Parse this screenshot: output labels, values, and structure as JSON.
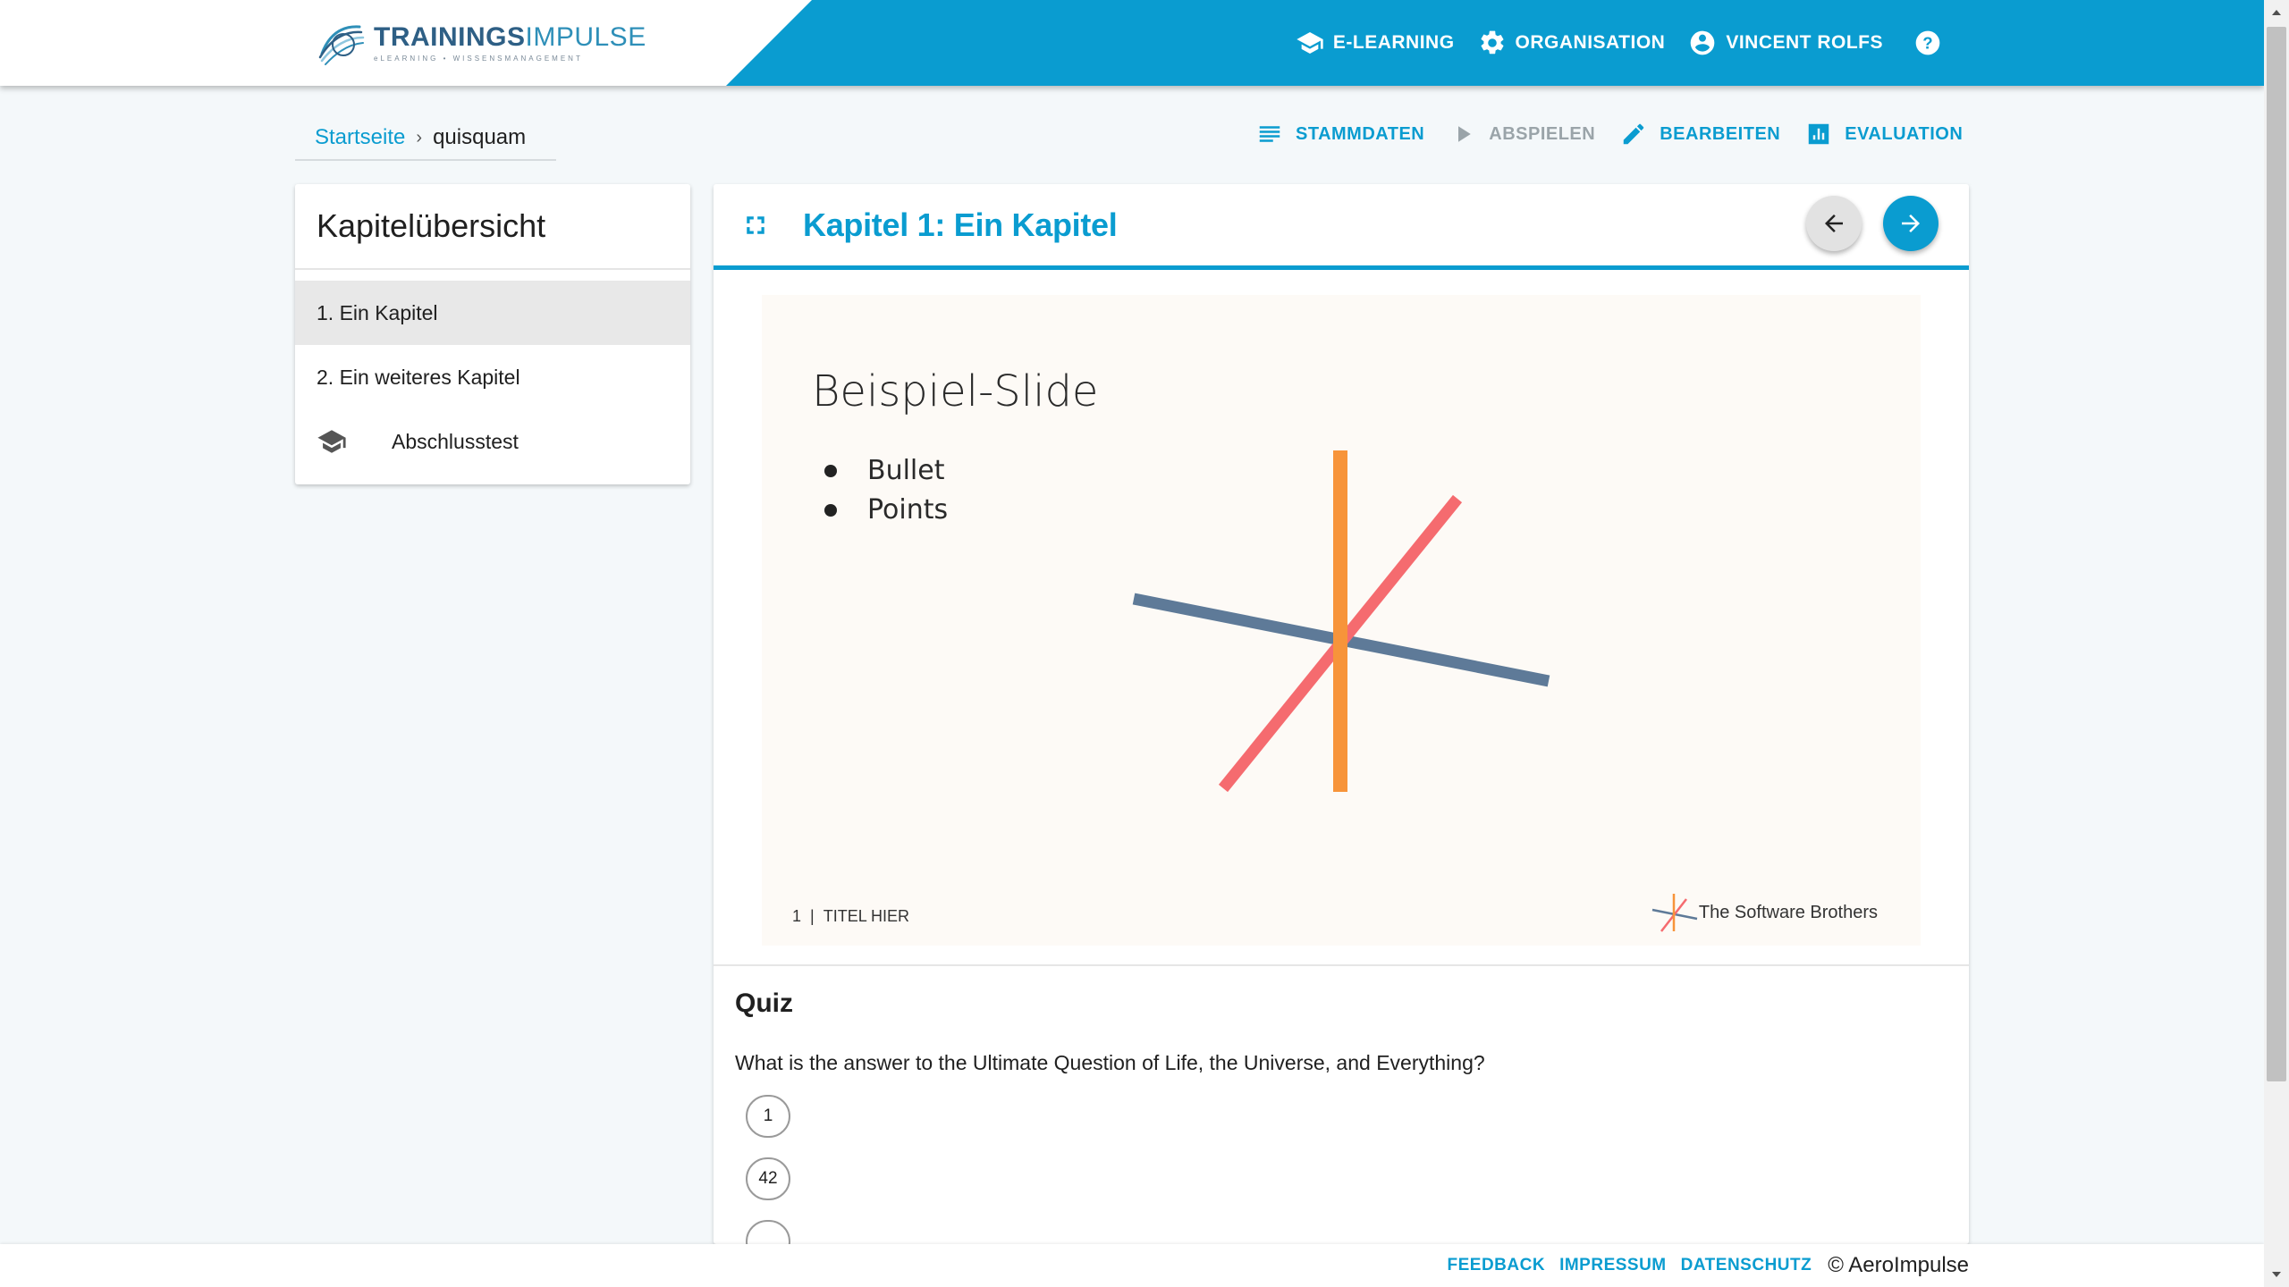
{
  "header": {
    "logo": {
      "brand_bold": "TRAININGS",
      "brand_light": "IMPULSE",
      "tagline": "eLEARNING • WISSENSMANAGEMENT"
    },
    "nav": [
      {
        "label": "E-LEARNING",
        "icon": "graduation-cap-icon"
      },
      {
        "label": "ORGANISATION",
        "icon": "gear-icon"
      },
      {
        "label": "VINCENT ROLFS",
        "icon": "account-circle-icon"
      }
    ],
    "help_icon": "help-circle-icon"
  },
  "breadcrumb": {
    "home": "Startseite",
    "separator": "›",
    "current": "quisquam"
  },
  "actions": [
    {
      "label": "STAMMDATEN",
      "icon": "list-icon",
      "enabled": true
    },
    {
      "label": "ABSPIELEN",
      "icon": "play-icon",
      "enabled": false
    },
    {
      "label": "BEARBEITEN",
      "icon": "pencil-icon",
      "enabled": true
    },
    {
      "label": "EVALUATION",
      "icon": "bar-chart-icon",
      "enabled": true
    }
  ],
  "sidebar": {
    "title": "Kapitelübersicht",
    "items": [
      {
        "label": "1. Ein Kapitel",
        "active": true
      },
      {
        "label": "2. Ein weiteres Kapitel",
        "active": false
      },
      {
        "label": "Abschlusstest",
        "active": false,
        "icon": "graduation-cap-icon"
      }
    ]
  },
  "chapter": {
    "title": "Kapitel 1: Ein Kapitel",
    "slide": {
      "title": "Beispiel-Slide",
      "bullets": [
        "Bullet",
        "Points"
      ],
      "footer_number": "1",
      "footer_separator": "|",
      "footer_text": "TITEL HIER",
      "brand": "The Software Brothers"
    },
    "quiz": {
      "title": "Quiz",
      "question": "What is the answer to the Ultimate Question of Life, the Universe, and Everything?",
      "options": [
        "1",
        "42"
      ]
    }
  },
  "footer": {
    "links": [
      "FEEDBACK",
      "IMPRESSUM",
      "DATENSCHUTZ"
    ],
    "copyright": "© AeroImpulse"
  },
  "colors": {
    "accent": "#0a9cd0",
    "slide_orange": "#f7943a",
    "slide_red": "#f56b6f",
    "slide_slate": "#5e7a98"
  }
}
